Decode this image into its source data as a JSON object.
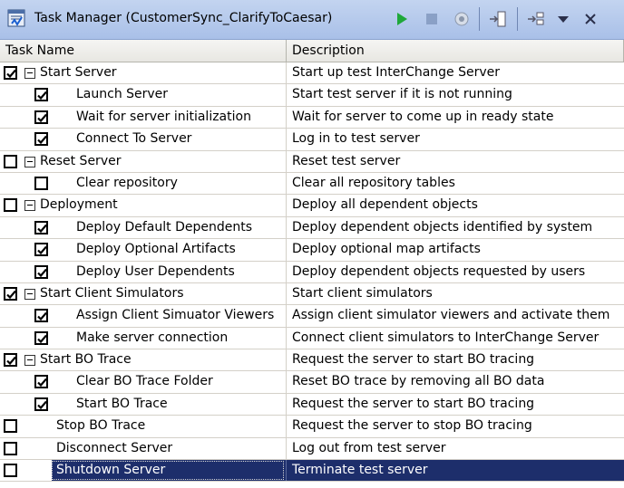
{
  "window": {
    "title": "Task Manager (CustomerSync_ClarifyToCaesar)",
    "accent": "#a9c0e8"
  },
  "toolbar": {
    "buttons": [
      "run-icon",
      "stop-icon",
      "record-icon",
      "import-icon",
      "export-icon",
      "menu-chevron-icon",
      "close-icon"
    ]
  },
  "columns": {
    "task_name": "Task Name",
    "description": "Description"
  },
  "rows": [
    {
      "name": "Start Server",
      "description": "Start up test InterChange Server",
      "checked": true,
      "level": 0,
      "expander": true
    },
    {
      "name": "Launch Server",
      "description": "Start test server if it is not running",
      "checked": true,
      "level": 1,
      "expander": false
    },
    {
      "name": "Wait for server initialization",
      "description": "Wait for server to come up in ready state",
      "checked": true,
      "level": 1,
      "expander": false
    },
    {
      "name": "Connect To Server",
      "description": "Log in to test server",
      "checked": true,
      "level": 1,
      "expander": false
    },
    {
      "name": "Reset Server",
      "description": "Reset test server",
      "checked": false,
      "level": 0,
      "expander": true
    },
    {
      "name": "Clear repository",
      "description": "Clear all repository tables",
      "checked": false,
      "level": 1,
      "expander": false
    },
    {
      "name": "Deployment",
      "description": "Deploy all dependent objects",
      "checked": false,
      "level": 0,
      "expander": true
    },
    {
      "name": "Deploy Default Dependents",
      "description": "Deploy dependent objects identified by system",
      "checked": true,
      "level": 1,
      "expander": false
    },
    {
      "name": "Deploy Optional Artifacts",
      "description": "Deploy optional map artifacts",
      "checked": true,
      "level": 1,
      "expander": false
    },
    {
      "name": "Deploy User Dependents",
      "description": "Deploy dependent objects requested by users",
      "checked": true,
      "level": 1,
      "expander": false
    },
    {
      "name": "Start Client Simulators",
      "description": "Start client simulators",
      "checked": true,
      "level": 0,
      "expander": true
    },
    {
      "name": "Assign Client Simuator Viewers",
      "description": "Assign client simulator viewers and activate them",
      "checked": true,
      "level": 1,
      "expander": false
    },
    {
      "name": "Make server connection",
      "description": "Connect client simulators to InterChange Server",
      "checked": true,
      "level": 1,
      "expander": false
    },
    {
      "name": "Start BO Trace",
      "description": "Request the server to start BO tracing",
      "checked": true,
      "level": 0,
      "expander": true
    },
    {
      "name": "Clear BO Trace Folder",
      "description": "Reset BO trace by removing all BO data",
      "checked": true,
      "level": 1,
      "expander": false
    },
    {
      "name": "Start BO Trace",
      "description": "Request the server to start BO tracing",
      "checked": true,
      "level": 1,
      "expander": false
    },
    {
      "name": "Stop BO Trace",
      "description": "Request the server to stop BO tracing",
      "checked": false,
      "level": 0,
      "expander": false
    },
    {
      "name": "Disconnect Server",
      "description": "Log out from test server",
      "checked": false,
      "level": 0,
      "expander": false
    },
    {
      "name": "Shutdown Server",
      "description": "Terminate test server",
      "checked": false,
      "level": 0,
      "expander": false,
      "selected": true
    }
  ]
}
